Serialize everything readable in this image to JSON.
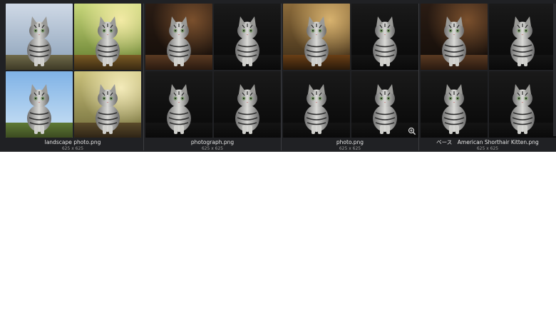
{
  "gallery": {
    "items": [
      {
        "filename": "landscape photo.png",
        "dimensions": "625 x 625",
        "thumbs": [
          {
            "bg": "landscape-mountains"
          },
          {
            "bg": "forest-sunlight"
          },
          {
            "bg": "sky-meadow"
          },
          {
            "bg": "garden-flowers"
          }
        ]
      },
      {
        "filename": "photograph.png",
        "dimensions": "625 x 625",
        "thumbs": [
          {
            "bg": "studio-warm"
          },
          {
            "bg": "studio-dark"
          },
          {
            "bg": "studio-dark"
          },
          {
            "bg": "studio-dark"
          }
        ]
      },
      {
        "filename": "photo.png",
        "dimensions": "625 x 625",
        "has_zoom_icon": true,
        "thumbs": [
          {
            "bg": "forest-autumn"
          },
          {
            "bg": "studio-dark"
          },
          {
            "bg": "studio-dark"
          },
          {
            "bg": "studio-dark"
          }
        ]
      },
      {
        "filename": "ベース　American Shorthair Kitten.png",
        "dimensions": "625 x 625",
        "thumbs": [
          {
            "bg": "studio-warm"
          },
          {
            "bg": "studio-dark"
          },
          {
            "bg": "studio-dark"
          },
          {
            "bg": "studio-dark"
          }
        ]
      }
    ]
  },
  "colors": {
    "panel_bg": "#202124",
    "caption_text": "#e8e8e8",
    "dims_text": "#9a9a9a"
  },
  "icons": {
    "zoom": "zoom-in-icon"
  }
}
